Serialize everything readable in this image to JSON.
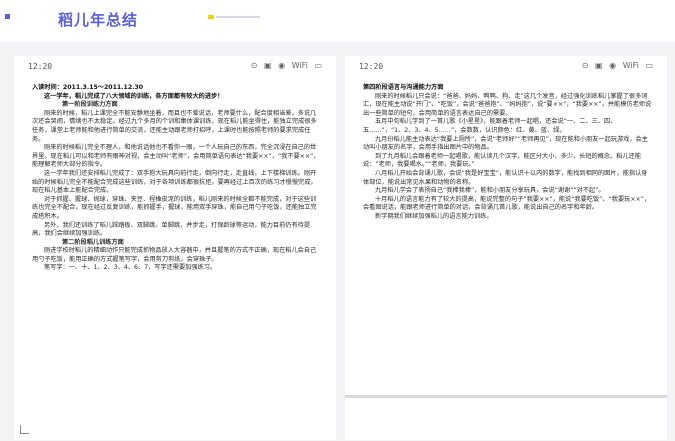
{
  "header": {
    "title": "稻儿年总结"
  },
  "status": {
    "time": "12:20",
    "icons": [
      "⊙",
      "▣",
      "◉",
      "WiFi",
      "▭"
    ]
  },
  "left_doc": {
    "line1": "入读时间：2011.3.15～2011.12.30",
    "line2": "这一学年，稻儿完成了八大领域的训练，各方面都有较大的进步！",
    "line3": "第一阶段训练力方面",
    "p1": "刚来的时候，稻儿上课完全不能安静地坐着，而且也不爱说话，老师要什么，配合度相当差，多说几次还会哭闹，情绪也不太稳定。经过九个多月的个训和集体课训练，现在稻儿能坐得住，能独立完成很多任务，课堂上老师能和他进行简单的交流，还能主动跟老师打招呼，上课时也能按照老师的要求完成任务。",
    "p2": "刚来的时候稻儿完全不理人，和他说话他也不看你一眼，一个人玩自己的东西，完全沉浸在自己的世界里。现在稻儿可以和老师有眼神对视，会主动叫“老师”，会用简单语句表达“我要××”，“我不要××”，能理解老师大部分的指令。",
    "p3": "这一学年我们还安排稻儿完成了：双手抱大玩具向前行走，倒向行走，走直线，上下楼梯训练。刚开始的时候稻儿完全不能配合完成这些训练，对于各项训练都很抗拒，要再经过上百次的练习才慢慢完成，现在稻儿基本上能配合完成。",
    "p4": "对于抓握、握球、抛球，穿珠、夹豆、捏橡皮泥的训练，稻儿刚来的时候全都不能完成，对于这些训练也完全不配合，现在经过反复训练，能抓握手，握球，能用双手穿珠，能自己用勺子吃饭，还能独立完成搭积木。",
    "p5": "另外，我们还训练了稻儿踩踏板、双脚跳、单脚跳，并步走，打保龄球等运动，能力目前仍有待提高，我们会继续加强训练。",
    "line4": "第二阶段稻儿训练方面",
    "p6": "刚进学校时稻儿的精细动作只能完成抓物品放入大容器中，并且握笔的方式不正确，现在稻儿会自己用勺子吃饭，能用正确的方式握笔写字，会用剪刀剪纸，会穿珠子。",
    "p7": "笔写字：一、十、1、2、3、4、6、7，写字还需要加强练习。"
  },
  "right_doc": {
    "line1": "第四阶段语言与沟通能力方面",
    "p1": "刚来的时候稻儿只会说：“爸爸、妈妈、鸭鸭、狗、走”这几个发音，经过强化训练稻儿掌握了很多词汇，现在能主动说“开门”、“吃饭”，会说“爸爸抱”、“妈妈抱”，说“要××”，“我要××”，并能模仿老师说出一些简单的短句，会用简单的语言表达自己的需要。",
    "p2": "五月中旬稻儿学到了一首儿歌《小星星》，能跟着老师一起唱，还会说“一、二、三、四、五……”，“1、2、3、4、5……”，会数数，认识颜色：红、黄、蓝、绿。",
    "p3": "九月份稻儿能主动表达“我要上厕所”，会说“老师好”“老师再见”，现在能和小朋友一起玩游戏，会主动叫小朋友的名字，会用手指出图片中的物品。",
    "p4": "到了九月稻儿会跟着老师一起唱歌，能认读几个汉字，能区分大小、多少、长短的概念。稻儿还能说：“老师，我要喝水。”“老师，我要玩。”",
    "p5": "八月稻儿开始会背诵儿歌，会说“我是好宝宝”，能认识十以内的数字，能找到相同的图片，能指认身体部位，能说出常见水果和动物的名称。",
    "p6": "九月稻儿学会了表扬自己“我棒我棒”，能和小朋友分享玩具，会说“谢谢”“对不起”。",
    "p7": "十月稻儿的语言能力有了较大的提高，能说完整的句子“我要××”，能说“我要吃饭”、“我要玩××”，会看图说话，能跟老师进行简单的对话，会背诵几首儿歌，能说出自己的名字和年龄。",
    "p8": "新学期我们继续加强稻儿的语言能力训练。"
  }
}
